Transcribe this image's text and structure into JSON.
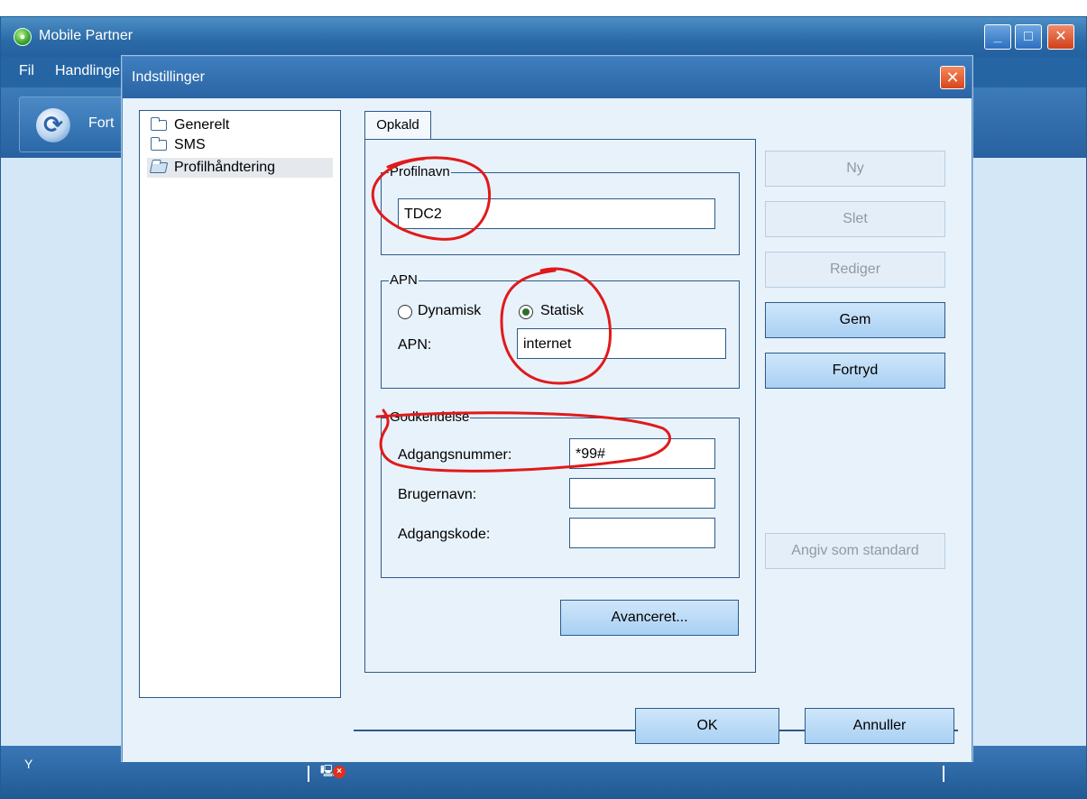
{
  "main_window": {
    "title": "Mobile Partner",
    "menu": [
      "Fil",
      "Handlinger"
    ],
    "toolbar_button_label": "Fort",
    "window_controls": {
      "minimize": "_",
      "maximize": "□",
      "close": "✕"
    },
    "status_signal": "Y",
    "status_disconnected": "×"
  },
  "dialog": {
    "title": "Indstillinger",
    "close": "✕",
    "tree": [
      {
        "label": "Generelt",
        "icon": "folder-icon"
      },
      {
        "label": "SMS",
        "icon": "folder-icon"
      },
      {
        "label": "Profilhåndtering",
        "icon": "folder-open-icon",
        "selected": true
      }
    ],
    "tab": "Opkald",
    "profile": {
      "legend": "Profilnavn",
      "value": "TDC2"
    },
    "apn": {
      "legend": "APN",
      "option_dynamic": "Dynamisk",
      "option_static": "Statisk",
      "selected": "Statisk",
      "label": "APN:",
      "value": "internet"
    },
    "auth": {
      "legend": "Godkendelse",
      "access_number_label": "Adgangsnummer:",
      "access_number_value": "*99#",
      "username_label": "Brugernavn:",
      "username_value": "",
      "password_label": "Adgangskode:",
      "password_value": ""
    },
    "advanced_button": "Avanceret...",
    "side_buttons": {
      "new": "Ny",
      "delete": "Slet",
      "edit": "Rediger",
      "save": "Gem",
      "undo": "Fortryd",
      "set_default": "Angiv som standard"
    },
    "ok": "OK",
    "cancel": "Annuller"
  },
  "colors": {
    "titlebar": "#2a64a4",
    "dialog_bg": "#e8f2fb",
    "annotation": "#e01a1a"
  }
}
